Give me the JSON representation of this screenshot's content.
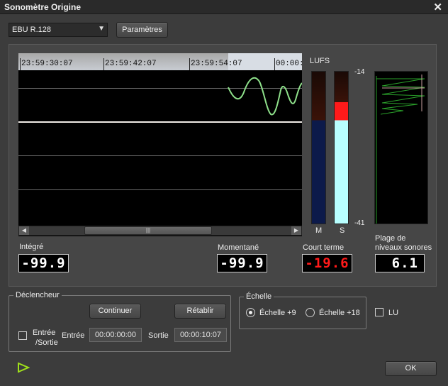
{
  "window": {
    "title": "Sonomètre  Origine",
    "close": "✕"
  },
  "toolbar": {
    "standard_value": "EBU R.128",
    "settings_label": "Paramètres"
  },
  "timeline": {
    "ticks": [
      "23:59:30:07",
      "23:59:42:07",
      "23:59:54:07",
      "00:00:0"
    ]
  },
  "meters": {
    "unit": "LUFS",
    "top": "-14",
    "bottom": "-41",
    "m_label": "M",
    "s_label": "S"
  },
  "readouts": {
    "integrated_label": "Intégré",
    "integrated_value": "-99.9",
    "momentary_label": "Momentané",
    "momentary_value": "-99.9",
    "short_term_label": "Court terme",
    "short_term_value": "-19.6",
    "range_label_1": "Plage de",
    "range_label_2": "niveaux sonores",
    "range_value": "6.1"
  },
  "trigger": {
    "title": "Déclencheur",
    "continue_label": "Continuer",
    "reset_label": "Rétablir",
    "checkbox_label_1": "Entrée",
    "checkbox_label_2": "/Sortie",
    "in_label": "Entrée",
    "in_value": "00:00:00:00",
    "out_label": "Sortie",
    "out_value": "00:00:10:07"
  },
  "scale": {
    "title": "Échelle",
    "opt1": "Échelle +9",
    "opt2": "Échelle +18",
    "selected": "Échelle +9"
  },
  "lu_label": "LU",
  "ok_label": "OK",
  "colors": {
    "green": "#8ee08a",
    "red": "#ff1a1a",
    "cyan": "#b8ffff",
    "navy": "#0c1a4a"
  }
}
